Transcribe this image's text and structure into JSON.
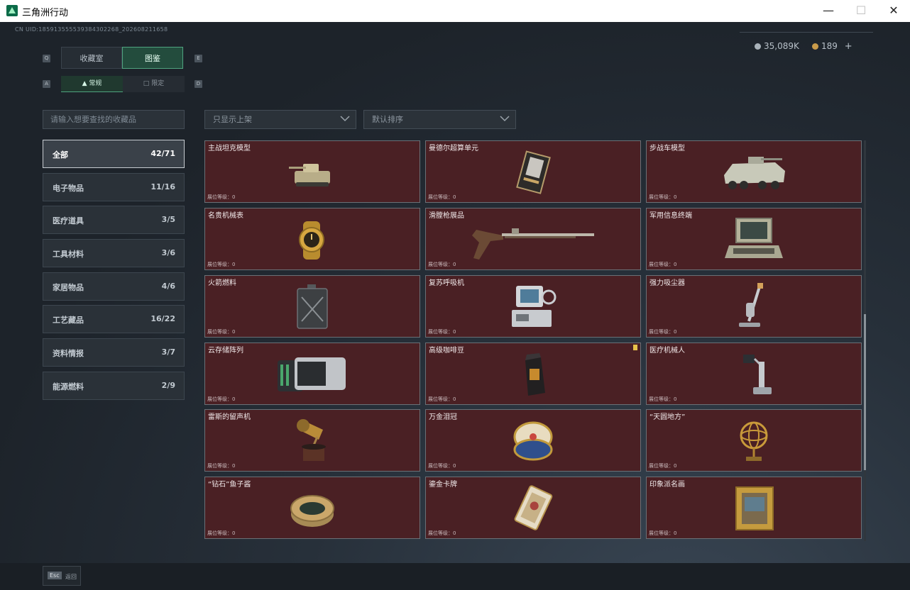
{
  "window": {
    "title": "三角洲行动"
  },
  "header": {
    "uid": "CN UID:18591355553938430226​8_202608211658",
    "currency1": "35,089K",
    "currency2": "189",
    "plus": "+"
  },
  "tabs": [
    {
      "label": "收藏室",
      "key": "Q"
    },
    {
      "label": "图鉴",
      "key": "E"
    }
  ],
  "subtabs": [
    {
      "label": "常规",
      "key": "A"
    },
    {
      "label": "限定",
      "key": "D"
    }
  ],
  "search": {
    "placeholder": "请输入想要查找的收藏品"
  },
  "filters": {
    "shelf": "只显示上架",
    "sort": "默认排序"
  },
  "categories": [
    {
      "name": "全部",
      "count": "42/71"
    },
    {
      "name": "电子物品",
      "count": "11/16"
    },
    {
      "name": "医疗道具",
      "count": "3/5"
    },
    {
      "name": "工具材料",
      "count": "3/6"
    },
    {
      "name": "家居物品",
      "count": "4/6"
    },
    {
      "name": "工艺藏品",
      "count": "16/22"
    },
    {
      "name": "资料情报",
      "count": "3/7"
    },
    {
      "name": "能源燃料",
      "count": "2/9"
    }
  ],
  "level_label": "展位等级：0",
  "items": [
    {
      "name": "主战坦克模型",
      "icon": "tank-model-icon"
    },
    {
      "name": "曼德尔超算单元",
      "icon": "supercomputer-unit-icon"
    },
    {
      "name": "步战车模型",
      "icon": "ifv-model-icon"
    },
    {
      "name": "名贵机械表",
      "icon": "gold-watch-icon"
    },
    {
      "name": "滑膛枪展品",
      "icon": "musket-icon"
    },
    {
      "name": "军用信息终端",
      "icon": "military-terminal-icon"
    },
    {
      "name": "火箭燃料",
      "icon": "fuel-canister-icon"
    },
    {
      "name": "复苏呼吸机",
      "icon": "ventilator-icon"
    },
    {
      "name": "强力吸尘器",
      "icon": "vacuum-cleaner-icon"
    },
    {
      "name": "云存储阵列",
      "icon": "storage-array-icon"
    },
    {
      "name": "高级咖啡豆",
      "icon": "coffee-bag-icon"
    },
    {
      "name": "医疗机械人",
      "icon": "medical-robot-icon"
    },
    {
      "name": "雷斯的留声机",
      "icon": "gramophone-icon"
    },
    {
      "name": "万金泪冠",
      "icon": "jeweled-egg-icon"
    },
    {
      "name": "“天圆地方”",
      "icon": "armillary-sphere-icon"
    },
    {
      "name": "“钻石”鱼子酱",
      "icon": "caviar-tin-icon"
    },
    {
      "name": "鎏金卡牌",
      "icon": "gilded-card-icon"
    },
    {
      "name": "印象派名画",
      "icon": "framed-painting-icon"
    }
  ],
  "footer": {
    "esc": "Esc",
    "back": "返回"
  },
  "colors": {
    "accent": "#4fa37f",
    "card_bg": "#4a2024",
    "bg": "#1f252b"
  }
}
